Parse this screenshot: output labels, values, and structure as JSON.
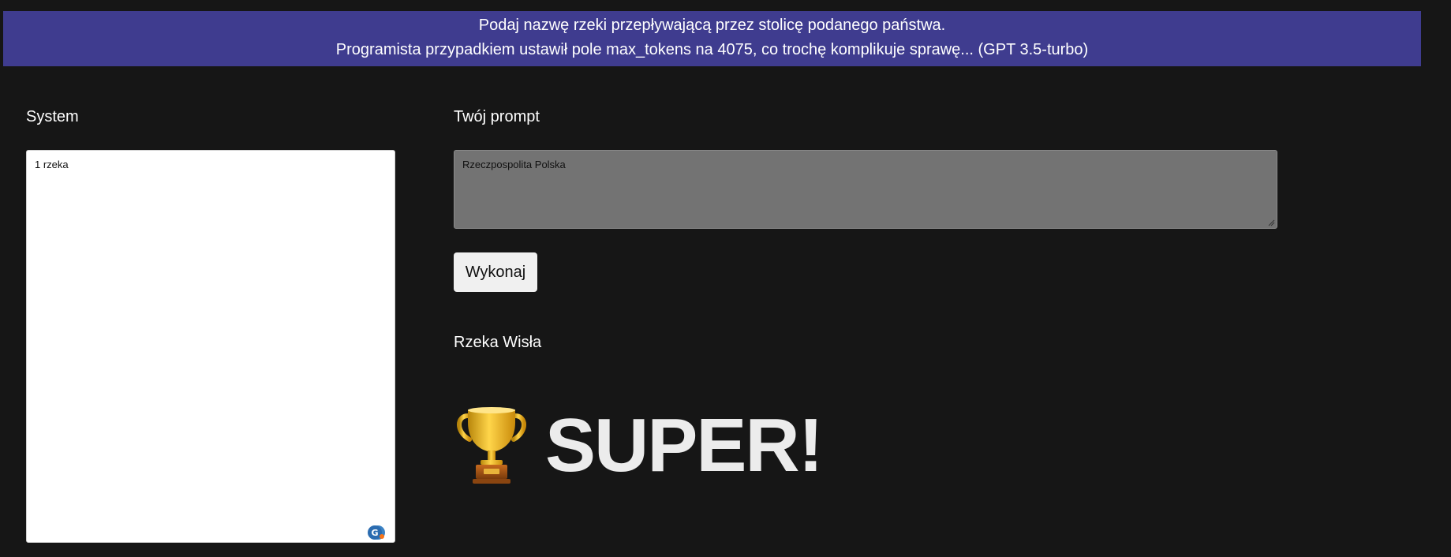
{
  "banner": {
    "line1": "Podaj nazwę rzeki przepływającą przez stolicę podanego państwa.",
    "line2": "Programista przypadkiem ustawił pole max_tokens na 4075, co trochę komplikuje sprawę... (GPT 3.5-turbo)"
  },
  "system": {
    "label": "System",
    "value": "1 rzeka"
  },
  "prompt": {
    "label": "Twój prompt",
    "value": "Rzeczpospolita Polska"
  },
  "actions": {
    "run_label": "Wykonaj"
  },
  "result": {
    "text": "Rzeka Wisła",
    "success_text": "SUPER!",
    "success_icon": "trophy-icon"
  },
  "colors": {
    "background": "#161616",
    "banner": "#3f3c8f",
    "prompt_box": "#737373",
    "button": "#f0f0f0"
  }
}
